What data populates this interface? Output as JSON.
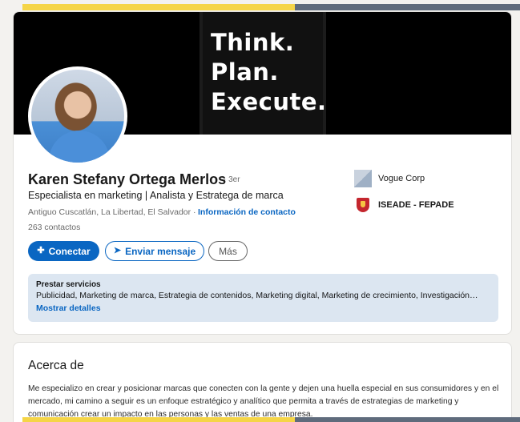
{
  "banner": {
    "lines": [
      "Think.",
      "Plan.",
      "Execute."
    ]
  },
  "profile": {
    "name": "Karen Stefany Ortega Merlos",
    "degree": "· 3er",
    "headline": "Especialista en marketing | Analista y Estratega de marca",
    "location": "Antiguo Cuscatlán, La Libertad, El Salvador ·",
    "contact_link": "Información de contacto",
    "connections": "263 contactos"
  },
  "actions": {
    "connect_label": "Conectar",
    "connect_icon": "add-person-icon",
    "message_label": "Enviar mensaje",
    "message_icon": "send-icon",
    "more_label": "Más"
  },
  "organizations": [
    {
      "name": "Vogue Corp",
      "icon": "company-logo-icon"
    },
    {
      "name": "ISEADE - FEPADE",
      "icon": "school-shield-icon"
    }
  ],
  "services": {
    "title": "Prestar servicios",
    "list": "Publicidad, Marketing de marca, Estrategia de contenidos, Marketing digital, Marketing de crecimiento, Investigación…",
    "link": "Mostrar detalles"
  },
  "about": {
    "title": "Acerca de",
    "text": "Me especializo en crear y posicionar marcas que conecten con la gente y dejen una huella especial en sus consumidores y en el mercado, mi camino a seguir es un enfoque estratégico y analítico que permita a través de estrategias de marketing y comunicación crear un impacto en las personas y las ventas de una empresa."
  },
  "colors": {
    "accent": "#0a66c2",
    "services_bg": "#dce6f1",
    "banner_bg": "#000000"
  }
}
